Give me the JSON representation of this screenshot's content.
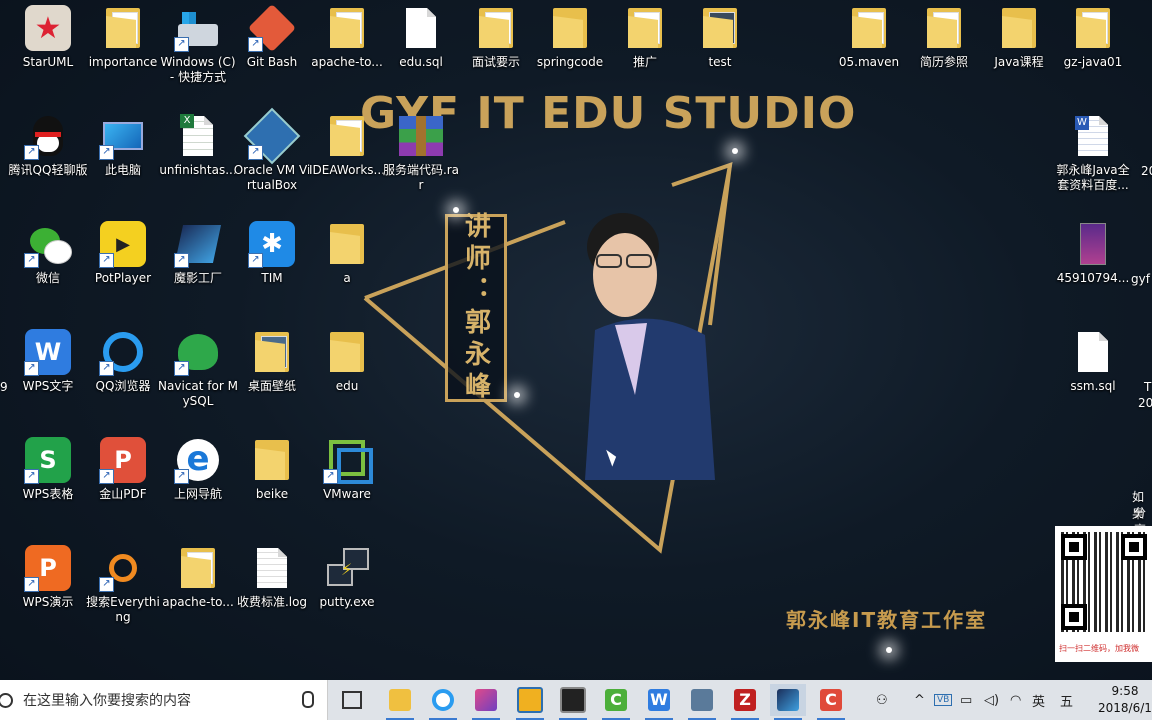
{
  "banner": {
    "title": "GYF IT EDU STUDIO",
    "lecturer": "讲师：郭永峰",
    "studio_cn": "郭永峰IT教育工作室"
  },
  "desktop_icons": [
    {
      "label": "StarUML",
      "icon": "staruml-icon"
    },
    {
      "label": "importance",
      "icon": "folder-icon"
    },
    {
      "label": "Windows (C) - 快捷方式",
      "icon": "drive-icon"
    },
    {
      "label": "Git Bash",
      "icon": "git-icon"
    },
    {
      "label": "apache-to...",
      "icon": "folder-icon"
    },
    {
      "label": "edu.sql",
      "icon": "file-icon"
    },
    {
      "label": "面试要示",
      "icon": "folder-icon"
    },
    {
      "label": "springcode",
      "icon": "folder-icon"
    },
    {
      "label": "推广",
      "icon": "folder-icon"
    },
    {
      "label": "test",
      "icon": "folder-icon"
    },
    {
      "label": "05.maven",
      "icon": "folder-icon"
    },
    {
      "label": "简历参照",
      "icon": "folder-icon"
    },
    {
      "label": "Java课程",
      "icon": "folder-icon"
    },
    {
      "label": "gz-java01",
      "icon": "folder-icon"
    },
    {
      "label": "腾讯QQ轻聊版",
      "icon": "qq-icon"
    },
    {
      "label": "此电脑",
      "icon": "computer-icon"
    },
    {
      "label": "unfinishtas...",
      "icon": "excel-icon"
    },
    {
      "label": "Oracle VM VirtualBox",
      "icon": "virtualbox-icon"
    },
    {
      "label": "IDEAWorks...",
      "icon": "folder-icon"
    },
    {
      "label": "服务端代码.rar",
      "icon": "rar-icon"
    },
    {
      "label": "郭永峰Java全套资料百度...",
      "icon": "word-icon"
    },
    {
      "label": "微信",
      "icon": "wechat-icon"
    },
    {
      "label": "PotPlayer",
      "icon": "potplayer-icon"
    },
    {
      "label": "魔影工厂",
      "icon": "moying-icon"
    },
    {
      "label": "TIM",
      "icon": "tim-icon"
    },
    {
      "label": "a",
      "icon": "folder-icon"
    },
    {
      "label": "45910794...",
      "icon": "image-icon"
    },
    {
      "label": "gyf",
      "icon": "file-icon"
    },
    {
      "label": "WPS文字",
      "icon": "wps-writer-icon"
    },
    {
      "label": "QQ浏览器",
      "icon": "qq-browser-icon"
    },
    {
      "label": "Navicat for MySQL",
      "icon": "navicat-icon"
    },
    {
      "label": "桌面壁纸",
      "icon": "folder-icon"
    },
    {
      "label": "edu",
      "icon": "folder-icon"
    },
    {
      "label": "ssm.sql",
      "icon": "file-icon"
    },
    {
      "label": "WPS表格",
      "icon": "wps-sheet-icon"
    },
    {
      "label": "金山PDF",
      "icon": "pdf-icon"
    },
    {
      "label": "上网导航",
      "icon": "ie-icon"
    },
    {
      "label": "beike",
      "icon": "folder-icon"
    },
    {
      "label": "VMware",
      "icon": "vmware-icon"
    },
    {
      "label": "WPS演示",
      "icon": "wps-present-icon"
    },
    {
      "label": "搜索Everything",
      "icon": "everything-icon"
    },
    {
      "label": "apache-to...",
      "icon": "folder-icon"
    },
    {
      "label": "收费标准.log",
      "icon": "file-icon"
    },
    {
      "label": "putty.exe",
      "icon": "putty-icon"
    }
  ],
  "right_edge_labels": [
    "20",
    "T",
    "20",
    "如果",
    "分享",
    "9"
  ],
  "qr": {
    "caption": "扫一扫二维码，加我微"
  },
  "taskbar": {
    "search_placeholder": "在这里输入你要搜索的内容",
    "ime_lang": "英",
    "ime_mode": "五",
    "tray_badge": "VB",
    "time": "9:58",
    "date": "2018/6/13"
  },
  "colors": {
    "gold": "#c9a25a",
    "desktop_bg": "#0f1a26",
    "taskbar_bg": "#dfe3e8"
  }
}
